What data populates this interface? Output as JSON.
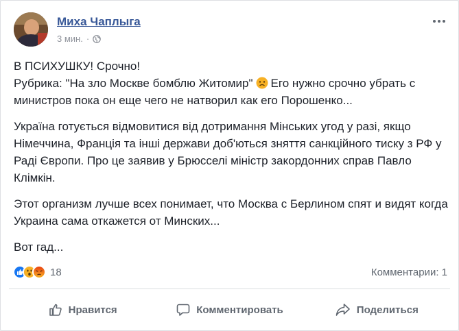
{
  "post": {
    "author": "Миха Чаплыга",
    "time": "3 мин.",
    "separator": "·",
    "audience_icon": "globe-icon",
    "more_icon": "more-icon",
    "paragraphs": {
      "p1": {
        "line1": "В ПСИХУШКУ! Срочно!",
        "line2_before": "Рубрика: \"На зло Москве бомблю Житомир\"",
        "line2_emoji": "frowning-face-icon",
        "line2_after": "Его нужно срочно убрать с министров пока он еще чего не натворил как его Порошенко..."
      },
      "p2": "Україна готується відмовитися від дотримання Мінських угод у разі, якщо Німеччина, Франція та інші держави доб'ються зняття санкційного тиску з РФ у Раді Європи. Про це заявив у Брюсселі міністр закордонних справ Павло Клімкін.",
      "p3": "Этот организм лучше всех понимает, что Москва с Берлином спят и видят когда Украина сама откажется от Минских...",
      "p4": "Вот гад..."
    }
  },
  "reactions": {
    "icons": [
      "like-icon",
      "wow-icon",
      "angry-icon"
    ],
    "count": "18",
    "comments": "Комментарии: 1"
  },
  "actions": {
    "like": "Нравится",
    "comment": "Комментировать",
    "share": "Поделиться"
  },
  "colors": {
    "author": "#385898",
    "like_blue": "#1877f2",
    "wow_yellow": "#f7b125",
    "angry_orange": "#e9710f",
    "secondary_text": "#606770"
  }
}
